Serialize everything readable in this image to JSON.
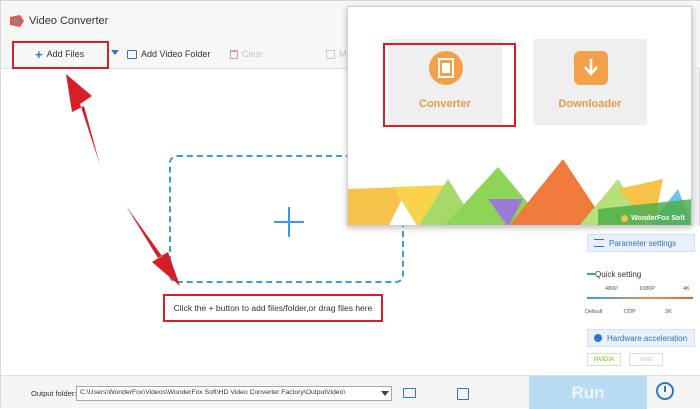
{
  "app": {
    "title": "Video Converter"
  },
  "toolbar": {
    "add_files": "Add Files",
    "add_video_folder": "Add Video Folder",
    "clear": "Clear",
    "merge_partial": "M"
  },
  "dropzone": {
    "hint": "Click the + button to add files/folder,or drag files here"
  },
  "sidepanel": {
    "parameter_settings": "Parameter settings",
    "quick_setting": "Quick setting",
    "resolutions_top": [
      "480P",
      "1080P",
      "4K"
    ],
    "resolutions_bottom": [
      "Default",
      "720P",
      "2K"
    ],
    "hardware_acceleration": "Hardware acceleration",
    "badges": [
      "NVIDIA",
      "Intel"
    ]
  },
  "bottombar": {
    "output_label": "Output folder:",
    "output_path": "C:\\Users\\WonderFox\\Videos\\WonderFox Soft\\HD Video Converter Factory\\OutputVideo\\",
    "run_label": "Run"
  },
  "popup": {
    "converter_label": "Converter",
    "downloader_label": "Downloader",
    "brand": "WonderFox Soft"
  },
  "colors": {
    "accent": "#3a9ae3",
    "highlight": "#d61f26",
    "tile_orange": "#e79a49",
    "run_button": "#b9dcf2"
  },
  "icons": [
    "app-logo-icon",
    "plus-icon",
    "chevron-down-icon",
    "folder-add-icon",
    "trash-icon",
    "film-icon",
    "download-icon",
    "sliders-icon",
    "chip-icon",
    "folder-icon",
    "export-icon",
    "alarm-icon"
  ]
}
